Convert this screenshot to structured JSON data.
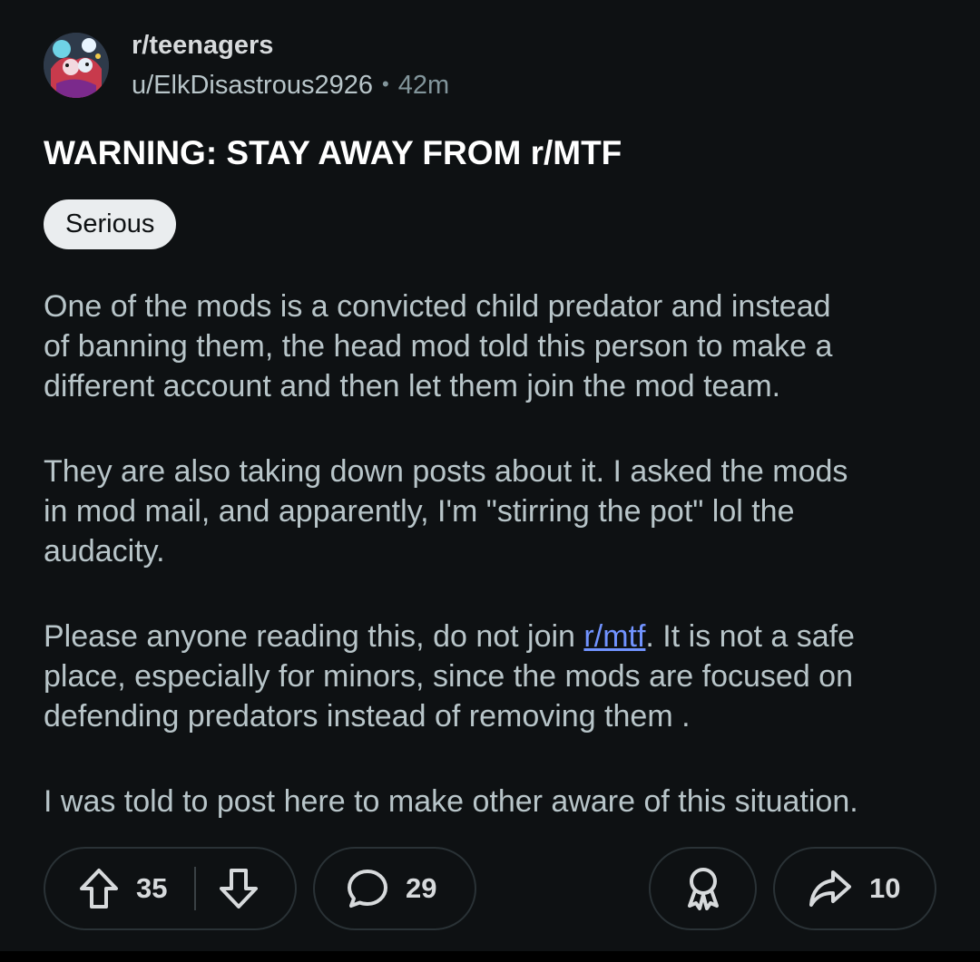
{
  "post": {
    "subreddit": "r/teenagers",
    "author": "u/ElkDisastrous2926",
    "separator": "•",
    "age": "42m",
    "title": "WARNING: STAY AWAY FROM r/MTF",
    "flair": "Serious",
    "paragraphs": {
      "p1": {
        "line1": "One of the mods is a convicted child predator and instead",
        "line2": "of banning them, the head mod told this person to make a",
        "line3": "different account and then let them join the mod team."
      },
      "p2": {
        "line1": "They are also taking down posts about it. I asked the mods",
        "line2": "in mod mail, and apparently, I'm \"stirring the pot\" lol the",
        "line3": "audacity."
      },
      "p3": {
        "line1_before": "Please anyone reading this, do not join ",
        "link_text": "r/mtf",
        "line1_after": ". It is not a safe",
        "line2": "place, especially for minors, since the mods are focused on",
        "line3": "defending predators instead of removing them ."
      },
      "p4": {
        "line1": "I was told to post here to make other aware of this situation."
      }
    }
  },
  "actions": {
    "upvote_icon": "upvote-arrow-icon",
    "score": "35",
    "downvote_icon": "downvote-arrow-icon",
    "comment_icon": "speech-bubble-icon",
    "comments": "29",
    "award_icon": "award-ribbon-icon",
    "share_icon": "share-arrow-icon",
    "shares": "10"
  },
  "colors": {
    "background": "#0e1113",
    "title": "#ffffff",
    "body_text": "#b8c5c9",
    "link": "#7193ff",
    "flair_bg": "#eaedef",
    "pill_border": "#2a3236"
  }
}
